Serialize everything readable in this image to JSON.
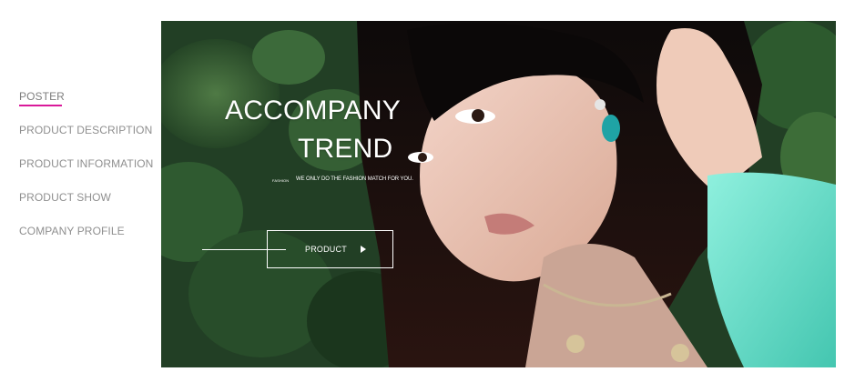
{
  "sidebar": {
    "items": [
      {
        "label": "POSTER",
        "active": true
      },
      {
        "label": "PRODUCT DESCRIPTION",
        "active": false
      },
      {
        "label": "PRODUCT INFORMATION",
        "active": false
      },
      {
        "label": "PRODUCT SHOW",
        "active": false
      },
      {
        "label": "COMPANY PROFILE",
        "active": false
      }
    ]
  },
  "hero": {
    "title_line1": "ACCOMPANY",
    "title_line2": "TREND",
    "tag": "FASHION",
    "subtitle": "WE ONLY DO THE FASHION MATCH FOR YOU.",
    "button_label": "PRODUCT",
    "button_icon": "play-icon"
  },
  "colors": {
    "accent": "#d9199a",
    "nav_text": "#8f8f8f",
    "hero_text": "#ffffff"
  }
}
